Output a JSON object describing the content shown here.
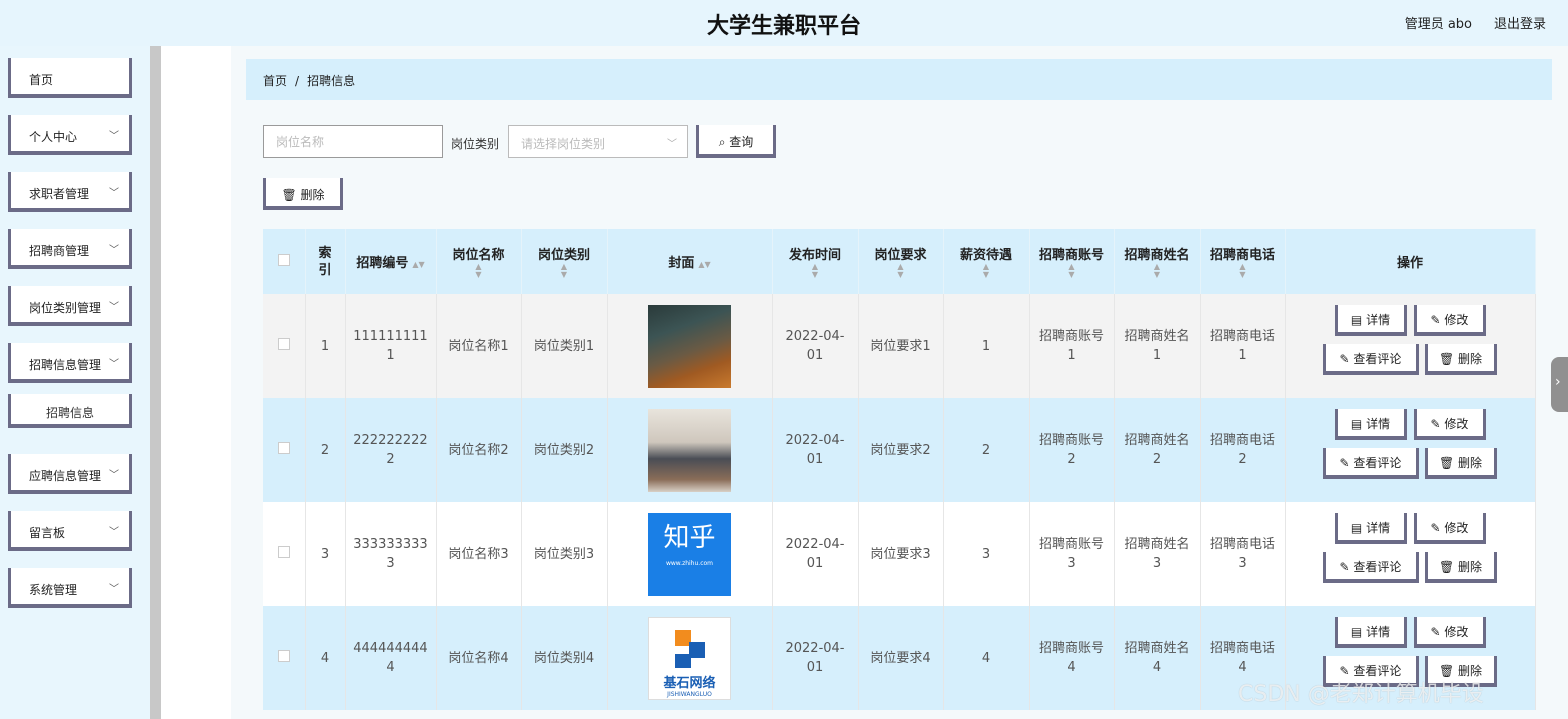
{
  "header": {
    "title": "大学生兼职平台",
    "admin": "管理员 abo",
    "logout": "退出登录"
  },
  "sidebar": {
    "items": [
      {
        "label": "首页",
        "expandable": false
      },
      {
        "label": "个人中心",
        "expandable": true
      },
      {
        "label": "求职者管理",
        "expandable": true
      },
      {
        "label": "招聘商管理",
        "expandable": true
      },
      {
        "label": "岗位类别管理",
        "expandable": true
      },
      {
        "label": "招聘信息管理",
        "expandable": true
      },
      {
        "label": "招聘信息",
        "expandable": false,
        "sub": true
      },
      {
        "label": "应聘信息管理",
        "expandable": true
      },
      {
        "label": "留言板",
        "expandable": true
      },
      {
        "label": "系统管理",
        "expandable": true
      }
    ]
  },
  "breadcrumb": {
    "home": "首页",
    "sep": "/",
    "current": "招聘信息"
  },
  "search": {
    "name_placeholder": "岗位名称",
    "category_label": "岗位类别",
    "category_placeholder": "请选择岗位类别",
    "query_label": "查询",
    "delete_label": "删除"
  },
  "table": {
    "headers": [
      "索引",
      "招聘编号",
      "岗位名称",
      "岗位类别",
      "封面",
      "发布时间",
      "岗位要求",
      "薪资待遇",
      "招聘商账号",
      "招聘商姓名",
      "招聘商电话",
      "操作"
    ],
    "rows": [
      {
        "index": "1",
        "code": "1111111111",
        "name": "岗位名称1",
        "category": "岗位类别1",
        "cover": "cafe-interior",
        "time": "2022-04-01",
        "req": "岗位要求1",
        "salary": "1",
        "account": "招聘商账号1",
        "rname": "招聘商姓名1",
        "phone": "招聘商电话1"
      },
      {
        "index": "2",
        "code": "2222222222",
        "name": "岗位名称2",
        "category": "岗位类别2",
        "cover": "office-meeting",
        "time": "2022-04-01",
        "req": "岗位要求2",
        "salary": "2",
        "account": "招聘商账号2",
        "rname": "招聘商姓名2",
        "phone": "招聘商电话2"
      },
      {
        "index": "3",
        "code": "3333333333",
        "name": "岗位名称3",
        "category": "岗位类别3",
        "cover": "zhihu-logo",
        "cover_text": "知乎",
        "cover_sub": "www.zhihu.com",
        "time": "2022-04-01",
        "req": "岗位要求3",
        "salary": "3",
        "account": "招聘商账号3",
        "rname": "招聘商姓名3",
        "phone": "招聘商电话3"
      },
      {
        "index": "4",
        "code": "4444444444",
        "name": "岗位名称4",
        "category": "岗位类别4",
        "cover": "jishi-logo",
        "cover_text": "基石网络",
        "cover_sub": "JISHIWANGLUO",
        "time": "2022-04-01",
        "req": "岗位要求4",
        "salary": "4",
        "account": "招聘商账号4",
        "rname": "招聘商姓名4",
        "phone": "招聘商电话4"
      }
    ],
    "ops": {
      "detail": "详情",
      "edit": "修改",
      "review": "查看评论",
      "delete": "删除"
    }
  },
  "watermark": "CSDN @老郑计算机毕设",
  "colors": {
    "accent": "#d6effc",
    "border": "#6b6b87"
  }
}
